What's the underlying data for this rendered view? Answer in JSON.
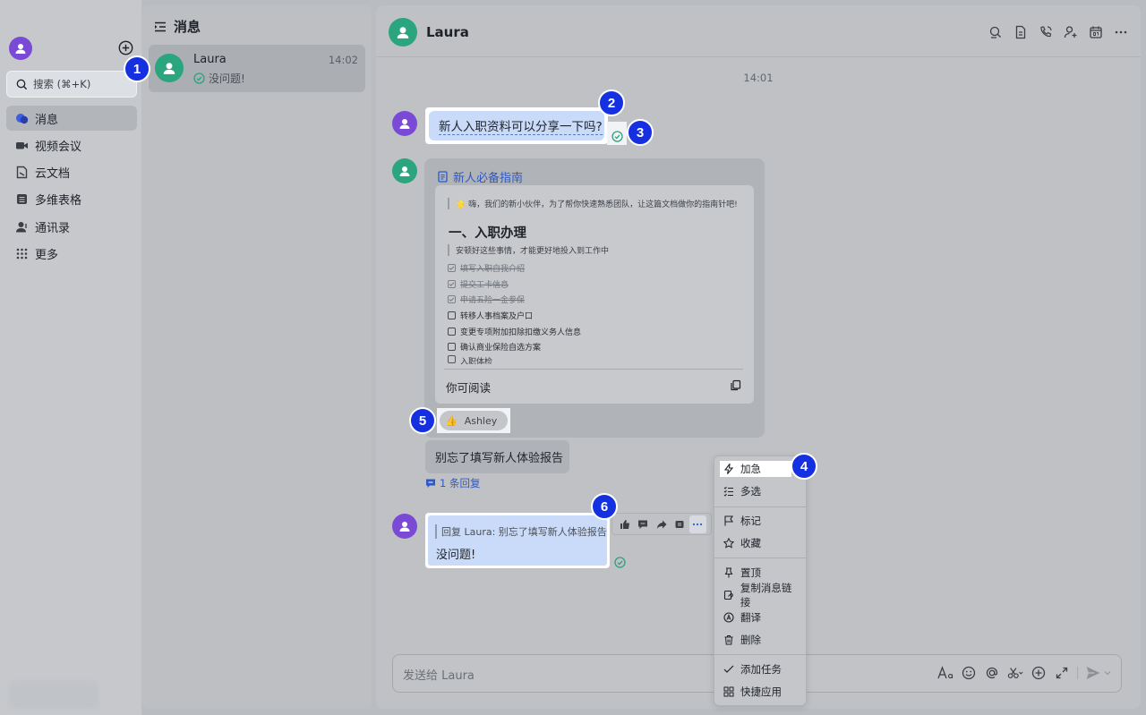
{
  "sidebar": {
    "search_label": "搜索 (⌘+K)",
    "items": [
      {
        "label": "消息",
        "icon": "chat-bubbles-icon",
        "active": true
      },
      {
        "label": "视频会议",
        "icon": "video-camera-icon",
        "active": false
      },
      {
        "label": "云文档",
        "icon": "cloud-doc-icon",
        "active": false
      },
      {
        "label": "多维表格",
        "icon": "table-icon",
        "active": false
      },
      {
        "label": "通讯录",
        "icon": "contacts-icon",
        "active": false
      },
      {
        "label": "更多",
        "icon": "grid-dots-icon",
        "active": false
      }
    ]
  },
  "chat_list": {
    "header": "消息",
    "items": [
      {
        "name": "Laura",
        "time": "14:02",
        "preview": "没问题!"
      }
    ]
  },
  "chat": {
    "title": "Laura",
    "timestamp": "14:01",
    "message1": "新人入职资料可以分享一下吗?",
    "card": {
      "title": "新人必备指南",
      "intro": "🌟 嗨，我们的新小伙伴，为了帮你快速熟悉团队，让这篇文档做你的指南针吧!",
      "heading": "一、入职办理",
      "subtitle": "安顿好这些事情，才能更好地投入到工作中",
      "checklist": [
        {
          "text": "填写入职自我介绍",
          "done": true
        },
        {
          "text": "提交工卡信息",
          "done": true
        },
        {
          "text": "申请五险一金参保",
          "done": true
        },
        {
          "text": "转移人事档案及户口",
          "done": false
        },
        {
          "text": "变更专项附加扣除扣缴义务人信息",
          "done": false
        },
        {
          "text": "确认商业保险自选方案",
          "done": false
        },
        {
          "text": "入职体检",
          "done": false
        }
      ],
      "permission": "你可阅读"
    },
    "reaction": {
      "user": "Ashley",
      "emoji": "👍"
    },
    "message2": "别忘了填写新人体验报告",
    "reply_count": "1 条回复",
    "message3": {
      "quote": "回复 Laura:  别忘了填写新人体验报告",
      "text": "没问题!"
    },
    "composer_placeholder": "发送给 Laura"
  },
  "context_menu": {
    "items": [
      "加急",
      "多选",
      "标记",
      "收藏",
      "置顶",
      "复制消息链接",
      "翻译",
      "删除",
      "添加任务",
      "快捷应用"
    ]
  },
  "callouts": [
    "1",
    "2",
    "3",
    "4",
    "5",
    "6"
  ],
  "colors": {
    "accent_blue": "#2d58c8",
    "badge_blue": "#1530e0",
    "avatar_purple": "#7a49d6",
    "avatar_green": "#2aa57d",
    "bubble_blue": "#c9dbf8"
  }
}
